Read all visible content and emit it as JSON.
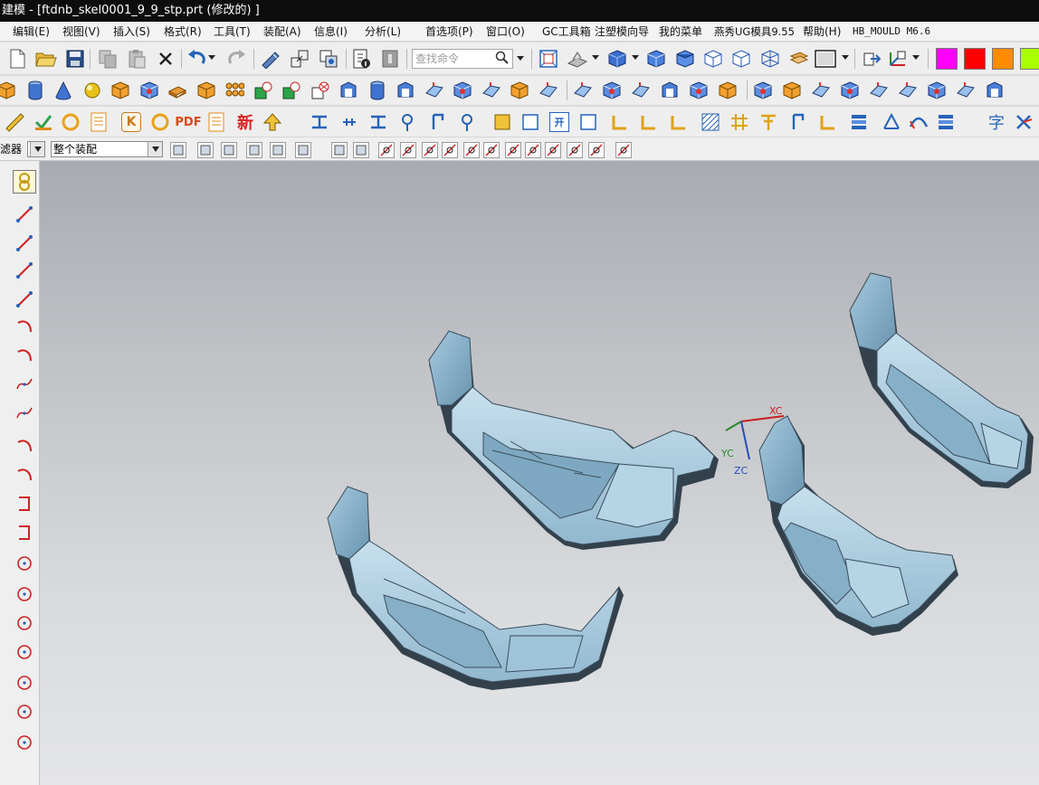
{
  "window": {
    "title": "建模 - [ftdnb_skel0001_9_9_stp.prt  (修改的) ]"
  },
  "menu": {
    "items": [
      "编辑(E)",
      "视图(V)",
      "插入(S)",
      "格式(R)",
      "工具(T)",
      "装配(A)",
      "信息(I)",
      "分析(L)",
      "首选项(P)",
      "窗口(O)",
      "GC工具箱",
      "注塑模向导",
      "我的菜单",
      "燕秀UG模具9.55",
      "帮助(H)",
      "HB_MOULD M6.6"
    ]
  },
  "toolbar": {
    "search_placeholder": "查找命令",
    "pdf_label": "PDF",
    "new_label": "新",
    "k_label": "K",
    "kai_label": "开",
    "zi_label": "字",
    "swatch_colors": [
      "#ff00ff",
      "#ff0000",
      "#ff8c00",
      "#aaff00"
    ]
  },
  "selection_bar": {
    "filter_label": "滤器",
    "scope_value": "整个装配"
  },
  "viewport": {
    "axes": {
      "x_label": "XC",
      "y_label": "YC",
      "z_label": "ZC"
    },
    "part_color": "#8fb7cf"
  }
}
